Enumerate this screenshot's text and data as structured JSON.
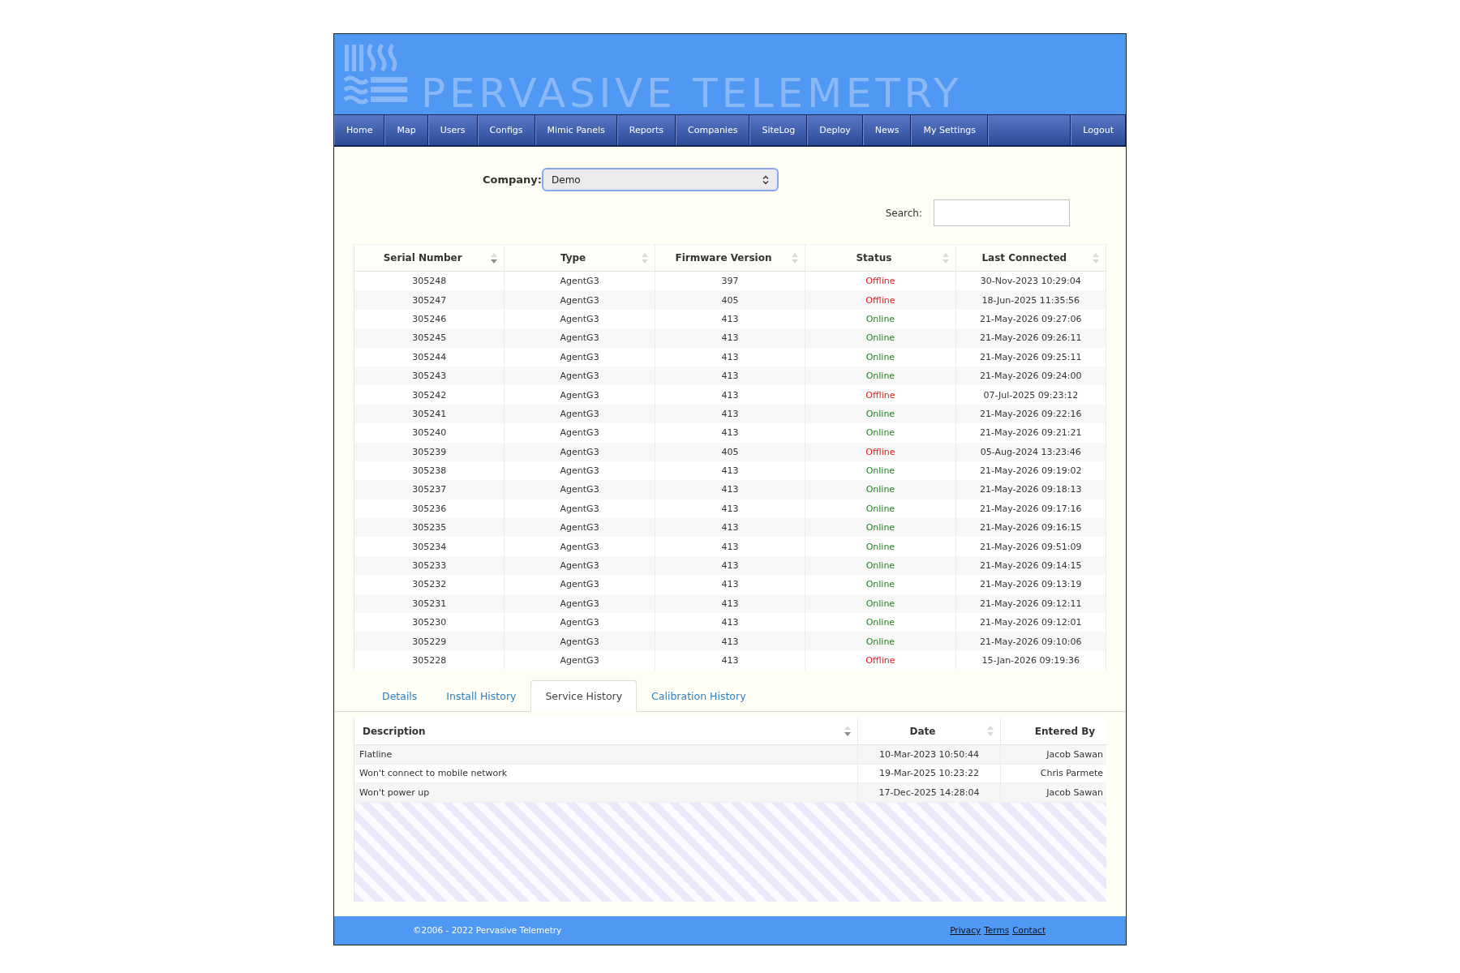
{
  "header": {
    "logo_text": "PERVASIVE TELEMETRY"
  },
  "nav": {
    "items": [
      "Home",
      "Map",
      "Users",
      "Configs",
      "Mimic Panels",
      "Reports",
      "Companies",
      "SiteLog",
      "Deploy",
      "News",
      "My Settings"
    ],
    "logout": "Logout"
  },
  "company": {
    "label": "Company:",
    "value": "Demo"
  },
  "search": {
    "label": "Search:"
  },
  "device_table": {
    "columns": [
      {
        "label": "Serial Number",
        "sortable": true,
        "sorted": true
      },
      {
        "label": "Type",
        "sortable": true,
        "sorted": false
      },
      {
        "label": "Firmware Version",
        "sortable": true,
        "sorted": false
      },
      {
        "label": "Status",
        "sortable": true,
        "sorted": false
      },
      {
        "label": "Last Connected",
        "sortable": true,
        "sorted": false
      }
    ],
    "rows": [
      {
        "serial": "305248",
        "type": "AgentG3",
        "firmware": "397",
        "status": "Offline",
        "online": false,
        "last_connected": "30-Nov-2023 10:29:04"
      },
      {
        "serial": "305247",
        "type": "AgentG3",
        "firmware": "405",
        "status": "Offline",
        "online": false,
        "last_connected": "18-Jun-2025 11:35:56"
      },
      {
        "serial": "305246",
        "type": "AgentG3",
        "firmware": "413",
        "status": "Online",
        "online": true,
        "last_connected": "21-May-2026 09:27:06"
      },
      {
        "serial": "305245",
        "type": "AgentG3",
        "firmware": "413",
        "status": "Online",
        "online": true,
        "last_connected": "21-May-2026 09:26:11"
      },
      {
        "serial": "305244",
        "type": "AgentG3",
        "firmware": "413",
        "status": "Online",
        "online": true,
        "last_connected": "21-May-2026 09:25:11"
      },
      {
        "serial": "305243",
        "type": "AgentG3",
        "firmware": "413",
        "status": "Online",
        "online": true,
        "last_connected": "21-May-2026 09:24:00"
      },
      {
        "serial": "305242",
        "type": "AgentG3",
        "firmware": "413",
        "status": "Offline",
        "online": false,
        "last_connected": "07-Jul-2025 09:23:12"
      },
      {
        "serial": "305241",
        "type": "AgentG3",
        "firmware": "413",
        "status": "Online",
        "online": true,
        "last_connected": "21-May-2026 09:22:16"
      },
      {
        "serial": "305240",
        "type": "AgentG3",
        "firmware": "413",
        "status": "Online",
        "online": true,
        "last_connected": "21-May-2026 09:21:21"
      },
      {
        "serial": "305239",
        "type": "AgentG3",
        "firmware": "405",
        "status": "Offline",
        "online": false,
        "last_connected": "05-Aug-2024 13:23:46"
      },
      {
        "serial": "305238",
        "type": "AgentG3",
        "firmware": "413",
        "status": "Online",
        "online": true,
        "last_connected": "21-May-2026 09:19:02"
      },
      {
        "serial": "305237",
        "type": "AgentG3",
        "firmware": "413",
        "status": "Online",
        "online": true,
        "last_connected": "21-May-2026 09:18:13"
      },
      {
        "serial": "305236",
        "type": "AgentG3",
        "firmware": "413",
        "status": "Online",
        "online": true,
        "last_connected": "21-May-2026 09:17:16"
      },
      {
        "serial": "305235",
        "type": "AgentG3",
        "firmware": "413",
        "status": "Online",
        "online": true,
        "last_connected": "21-May-2026 09:16:15"
      },
      {
        "serial": "305234",
        "type": "AgentG3",
        "firmware": "413",
        "status": "Online",
        "online": true,
        "last_connected": "21-May-2026 09:51:09"
      },
      {
        "serial": "305233",
        "type": "AgentG3",
        "firmware": "413",
        "status": "Online",
        "online": true,
        "last_connected": "21-May-2026 09:14:15"
      },
      {
        "serial": "305232",
        "type": "AgentG3",
        "firmware": "413",
        "status": "Online",
        "online": true,
        "last_connected": "21-May-2026 09:13:19"
      },
      {
        "serial": "305231",
        "type": "AgentG3",
        "firmware": "413",
        "status": "Online",
        "online": true,
        "last_connected": "21-May-2026 09:12:11"
      },
      {
        "serial": "305230",
        "type": "AgentG3",
        "firmware": "413",
        "status": "Online",
        "online": true,
        "last_connected": "21-May-2026 09:12:01"
      },
      {
        "serial": "305229",
        "type": "AgentG3",
        "firmware": "413",
        "status": "Online",
        "online": true,
        "last_connected": "21-May-2026 09:10:06"
      },
      {
        "serial": "305228",
        "type": "AgentG3",
        "firmware": "413",
        "status": "Offline",
        "online": false,
        "last_connected": "15-Jan-2026 09:19:36"
      }
    ]
  },
  "tabs": [
    {
      "label": "Details",
      "selected": false
    },
    {
      "label": "Install History",
      "selected": false
    },
    {
      "label": "Service History",
      "selected": true
    },
    {
      "label": "Calibration History",
      "selected": false
    }
  ],
  "service_table": {
    "columns": [
      {
        "label": "Description",
        "sortable": true,
        "sorted": true
      },
      {
        "label": "Date",
        "sortable": true,
        "sorted": false
      },
      {
        "label": "Entered By",
        "sortable": false
      }
    ],
    "rows": [
      {
        "description": "Flatline",
        "date": "10-Mar-2023 10:50:44",
        "entered_by": "Jacob Sawan"
      },
      {
        "description": "Won't connect to mobile network",
        "date": "19-Mar-2025 10:23:22",
        "entered_by": "Chris Parmete"
      },
      {
        "description": "Won't power up",
        "date": "17-Dec-2025 14:28:04",
        "entered_by": "Jacob Sawan"
      }
    ]
  },
  "footer": {
    "copyright": "©2006 - 2022 Pervasive Telemetry",
    "links": [
      "Privacy",
      "Terms",
      "Contact"
    ]
  }
}
